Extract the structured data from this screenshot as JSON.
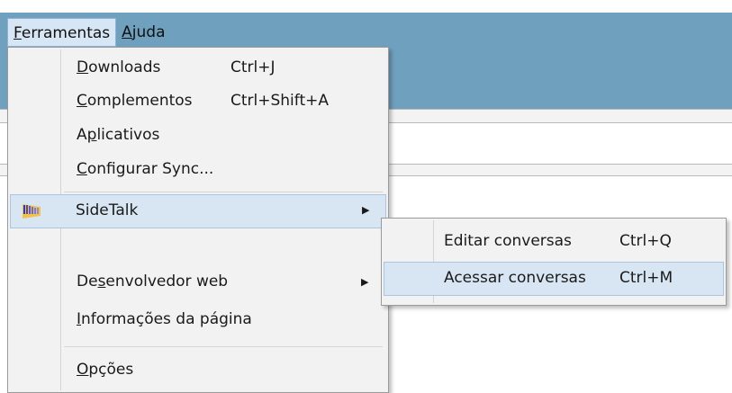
{
  "menubar": {
    "items": [
      {
        "label": "Ferramentas",
        "accel": "F",
        "rest": "erramentas",
        "active": true
      },
      {
        "label": "Ajuda",
        "accel": "A",
        "rest": "juda",
        "active": false
      }
    ]
  },
  "tools_menu": {
    "items": [
      {
        "pre": "",
        "accel": "D",
        "post": "ownloads",
        "shortcut": "Ctrl+J"
      },
      {
        "pre": "",
        "accel": "C",
        "post": "omplementos",
        "shortcut": "Ctrl+Shift+A"
      },
      {
        "pre": "A",
        "accel": "p",
        "post": "licativos",
        "shortcut": ""
      },
      {
        "pre": "",
        "accel": "C",
        "post": "onfigurar Sync...",
        "shortcut": ""
      },
      {
        "pre": "SideTalk",
        "accel": "",
        "post": "",
        "shortcut": "",
        "submenu": true,
        "highlighted": true,
        "icon": "sidetalk-icon"
      },
      {
        "pre": "De",
        "accel": "s",
        "post": "envolvedor web",
        "shortcut": "",
        "submenu": true
      },
      {
        "pre": "",
        "accel": "I",
        "post": "nformações da página",
        "shortcut": ""
      },
      {
        "pre": "",
        "accel": "O",
        "post": "pções",
        "shortcut": ""
      }
    ]
  },
  "sidetalk_submenu": {
    "items": [
      {
        "label": "Editar conversas",
        "shortcut": "Ctrl+Q"
      },
      {
        "label": "Acessar conversas",
        "shortcut": "Ctrl+M",
        "highlighted": true
      }
    ]
  },
  "colors": {
    "titlebar": "#6fa1bf",
    "menu_bg": "#f2f2f2",
    "highlight_bg": "#d8e6f3",
    "highlight_border": "#a9c5e2"
  }
}
